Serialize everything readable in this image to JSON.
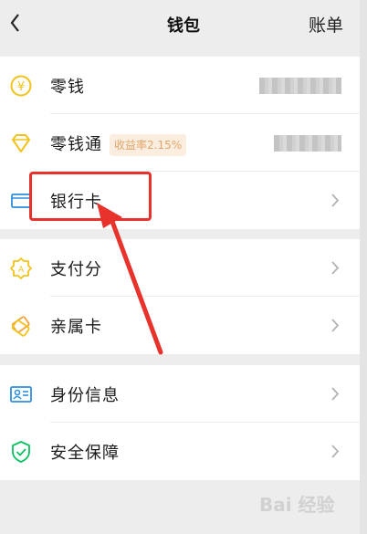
{
  "header": {
    "title": "钱包",
    "right_action": "账单"
  },
  "group1": [
    {
      "id": "change",
      "label": "零钱",
      "icon": "yen-coin-icon"
    },
    {
      "id": "change-plus",
      "label": "零钱通",
      "badge": "收益率2.15%",
      "icon": "diamond-icon"
    },
    {
      "id": "bank-card",
      "label": "银行卡",
      "icon": "card-icon"
    }
  ],
  "group2": [
    {
      "id": "pay-score",
      "label": "支付分",
      "icon": "score-badge-icon"
    },
    {
      "id": "family-card",
      "label": "亲属卡",
      "icon": "family-card-icon"
    }
  ],
  "group3": [
    {
      "id": "identity",
      "label": "身份信息",
      "icon": "id-card-icon"
    },
    {
      "id": "security",
      "label": "安全保障",
      "icon": "shield-check-icon"
    }
  ],
  "watermark": "Bai 经验",
  "colors": {
    "accent_yellow": "#f2c21b",
    "accent_green": "#07c160",
    "annotation_red": "#e8322c",
    "badge_text": "#e0a568",
    "badge_bg": "#fbeee0"
  }
}
